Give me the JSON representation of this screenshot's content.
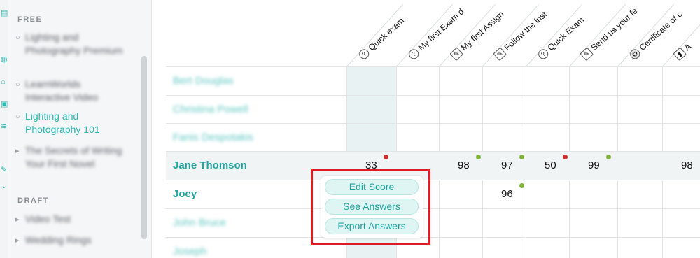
{
  "sidebar": {
    "sections": [
      {
        "title": "FREE"
      },
      {
        "title": "DRAFT"
      }
    ],
    "free_items": [
      {
        "label": "Lighting and Photography Premium"
      },
      {
        "label": "LearnWorlds Interactive Video"
      },
      {
        "label": "Lighting and Photography 101"
      },
      {
        "label": "The Secrets of Writing Your First Novel"
      }
    ],
    "draft_items": [
      {
        "label": "Video Test"
      },
      {
        "label": "Wedding Rings"
      }
    ]
  },
  "columns": [
    {
      "label": "Quick exam",
      "icon": "question-circle-icon"
    },
    {
      "label": "My first Exam d",
      "icon": "question-circle-icon"
    },
    {
      "label": "My first Assign",
      "icon": "edit-square-icon"
    },
    {
      "label": "Follow the inst",
      "icon": "edit-square-icon"
    },
    {
      "label": "Quick Exam",
      "icon": "question-circle-icon"
    },
    {
      "label": "Send us your fe",
      "icon": "edit-square-icon"
    },
    {
      "label": "Certificate of c",
      "icon": "award-icon"
    },
    {
      "label": "A",
      "icon": "bar-chart-icon"
    }
  ],
  "students": [
    {
      "name": "Bert Douglas",
      "scores": [
        "",
        "",
        "",
        "",
        "",
        "",
        "",
        ""
      ]
    },
    {
      "name": "Christina Powell",
      "scores": [
        "",
        "",
        "",
        "",
        "",
        "",
        "",
        ""
      ]
    },
    {
      "name": "Fanis Despotakis",
      "scores": [
        "",
        "",
        "",
        "",
        "",
        "",
        "",
        ""
      ]
    },
    {
      "name": "Jane Thomson",
      "scores": [
        "33",
        "",
        "98",
        "97",
        "50",
        "99",
        "",
        "98"
      ]
    },
    {
      "name": "Joey",
      "scores": [
        "",
        "",
        "",
        "96",
        "",
        "",
        "",
        ""
      ]
    },
    {
      "name": "John Bruce",
      "scores": [
        "",
        "",
        "",
        "",
        "",
        "",
        "",
        ""
      ]
    },
    {
      "name": "Joseph",
      "scores": [
        "",
        "",
        "",
        "",
        "",
        "",
        "",
        ""
      ]
    }
  ],
  "status_colors": {
    "fail": "#d0312d",
    "pass": "#7fb239"
  },
  "popup": {
    "edit_score": "Edit Score",
    "see_answers": "See Answers",
    "export_answers": "Export Answers"
  }
}
